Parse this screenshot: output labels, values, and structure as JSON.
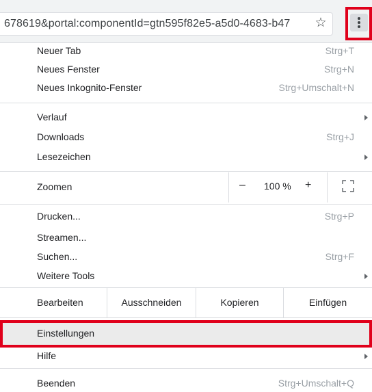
{
  "address_bar": {
    "url_text": "678619&portal:componentId=gtn595f82e5-a5d0-4683-b47",
    "star_icon": "star-icon",
    "menu_icon": "three-dots-vertical-icon"
  },
  "menu": {
    "new_tab": {
      "label": "Neuer Tab",
      "shortcut": "Strg+T"
    },
    "new_window": {
      "label": "Neues Fenster",
      "shortcut": "Strg+N"
    },
    "incognito": {
      "label": "Neues Inkognito-Fenster",
      "shortcut": "Strg+Umschalt+N"
    },
    "history": {
      "label": "Verlauf"
    },
    "downloads": {
      "label": "Downloads",
      "shortcut": "Strg+J"
    },
    "bookmarks": {
      "label": "Lesezeichen"
    },
    "zoom": {
      "label": "Zoomen",
      "minus": "–",
      "value": "100 %",
      "plus": "+"
    },
    "print": {
      "label": "Drucken...",
      "shortcut": "Strg+P"
    },
    "cast": {
      "label": "Streamen..."
    },
    "find": {
      "label": "Suchen...",
      "shortcut": "Strg+F"
    },
    "more_tools": {
      "label": "Weitere Tools"
    },
    "edit": {
      "label": "Bearbeiten",
      "cut": "Ausschneiden",
      "copy": "Kopieren",
      "paste": "Einfügen"
    },
    "settings": {
      "label": "Einstellungen"
    },
    "help": {
      "label": "Hilfe"
    },
    "exit": {
      "label": "Beenden",
      "shortcut": "Strg+Umschalt+Q"
    }
  },
  "colors": {
    "highlight": "#e0001b",
    "hover": "#ebebeb"
  }
}
